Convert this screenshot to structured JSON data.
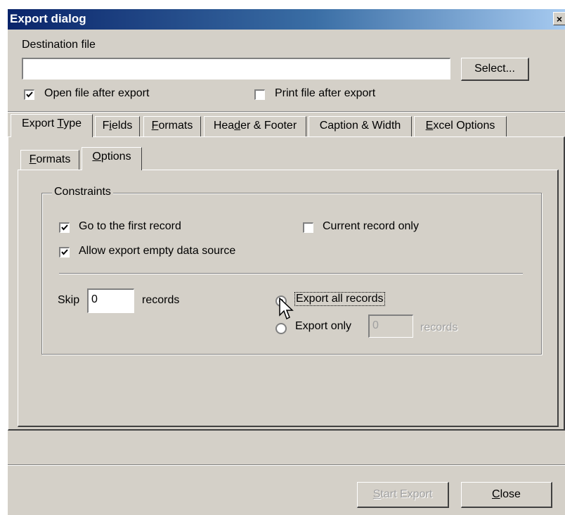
{
  "window": {
    "title": "Export dialog",
    "close_glyph": "×"
  },
  "destination": {
    "label": "Destination file",
    "value": "",
    "select_button": "Select..."
  },
  "after_export": {
    "open_file": {
      "label": "Open file after export",
      "checked": true
    },
    "print_file": {
      "label": "Print file after export",
      "checked": false
    }
  },
  "main_tabs": [
    {
      "label": "Export Type",
      "accel": "T",
      "active": true
    },
    {
      "label": "Fields",
      "accel": "i",
      "active": false
    },
    {
      "label": "Formats",
      "accel": "F",
      "active": false
    },
    {
      "label": "Header & Footer",
      "accel": "d",
      "active": false
    },
    {
      "label": "Caption & Width",
      "accel": "",
      "active": false
    },
    {
      "label": "Excel Options",
      "accel": "E",
      "active": false
    }
  ],
  "sub_tabs": [
    {
      "label": "Formats",
      "accel": "F",
      "active": false
    },
    {
      "label": "Options",
      "accel": "O",
      "active": true
    }
  ],
  "constraints": {
    "title": "Constraints",
    "go_first_record": {
      "label": "Go to the first record",
      "checked": true
    },
    "current_record_only": {
      "label": "Current record only",
      "checked": false
    },
    "allow_empty": {
      "label": "Allow export empty data source",
      "checked": true
    },
    "skip": {
      "label": "Skip",
      "value": "0",
      "suffix": "records"
    },
    "export_all": {
      "label": "Export all records",
      "selected": true
    },
    "export_only": {
      "label": "Export only",
      "value": "0",
      "suffix": "records",
      "selected": false
    }
  },
  "footer": {
    "start_export": "Start Export",
    "start_accel": "S",
    "close": "Close",
    "close_accel": "C"
  }
}
